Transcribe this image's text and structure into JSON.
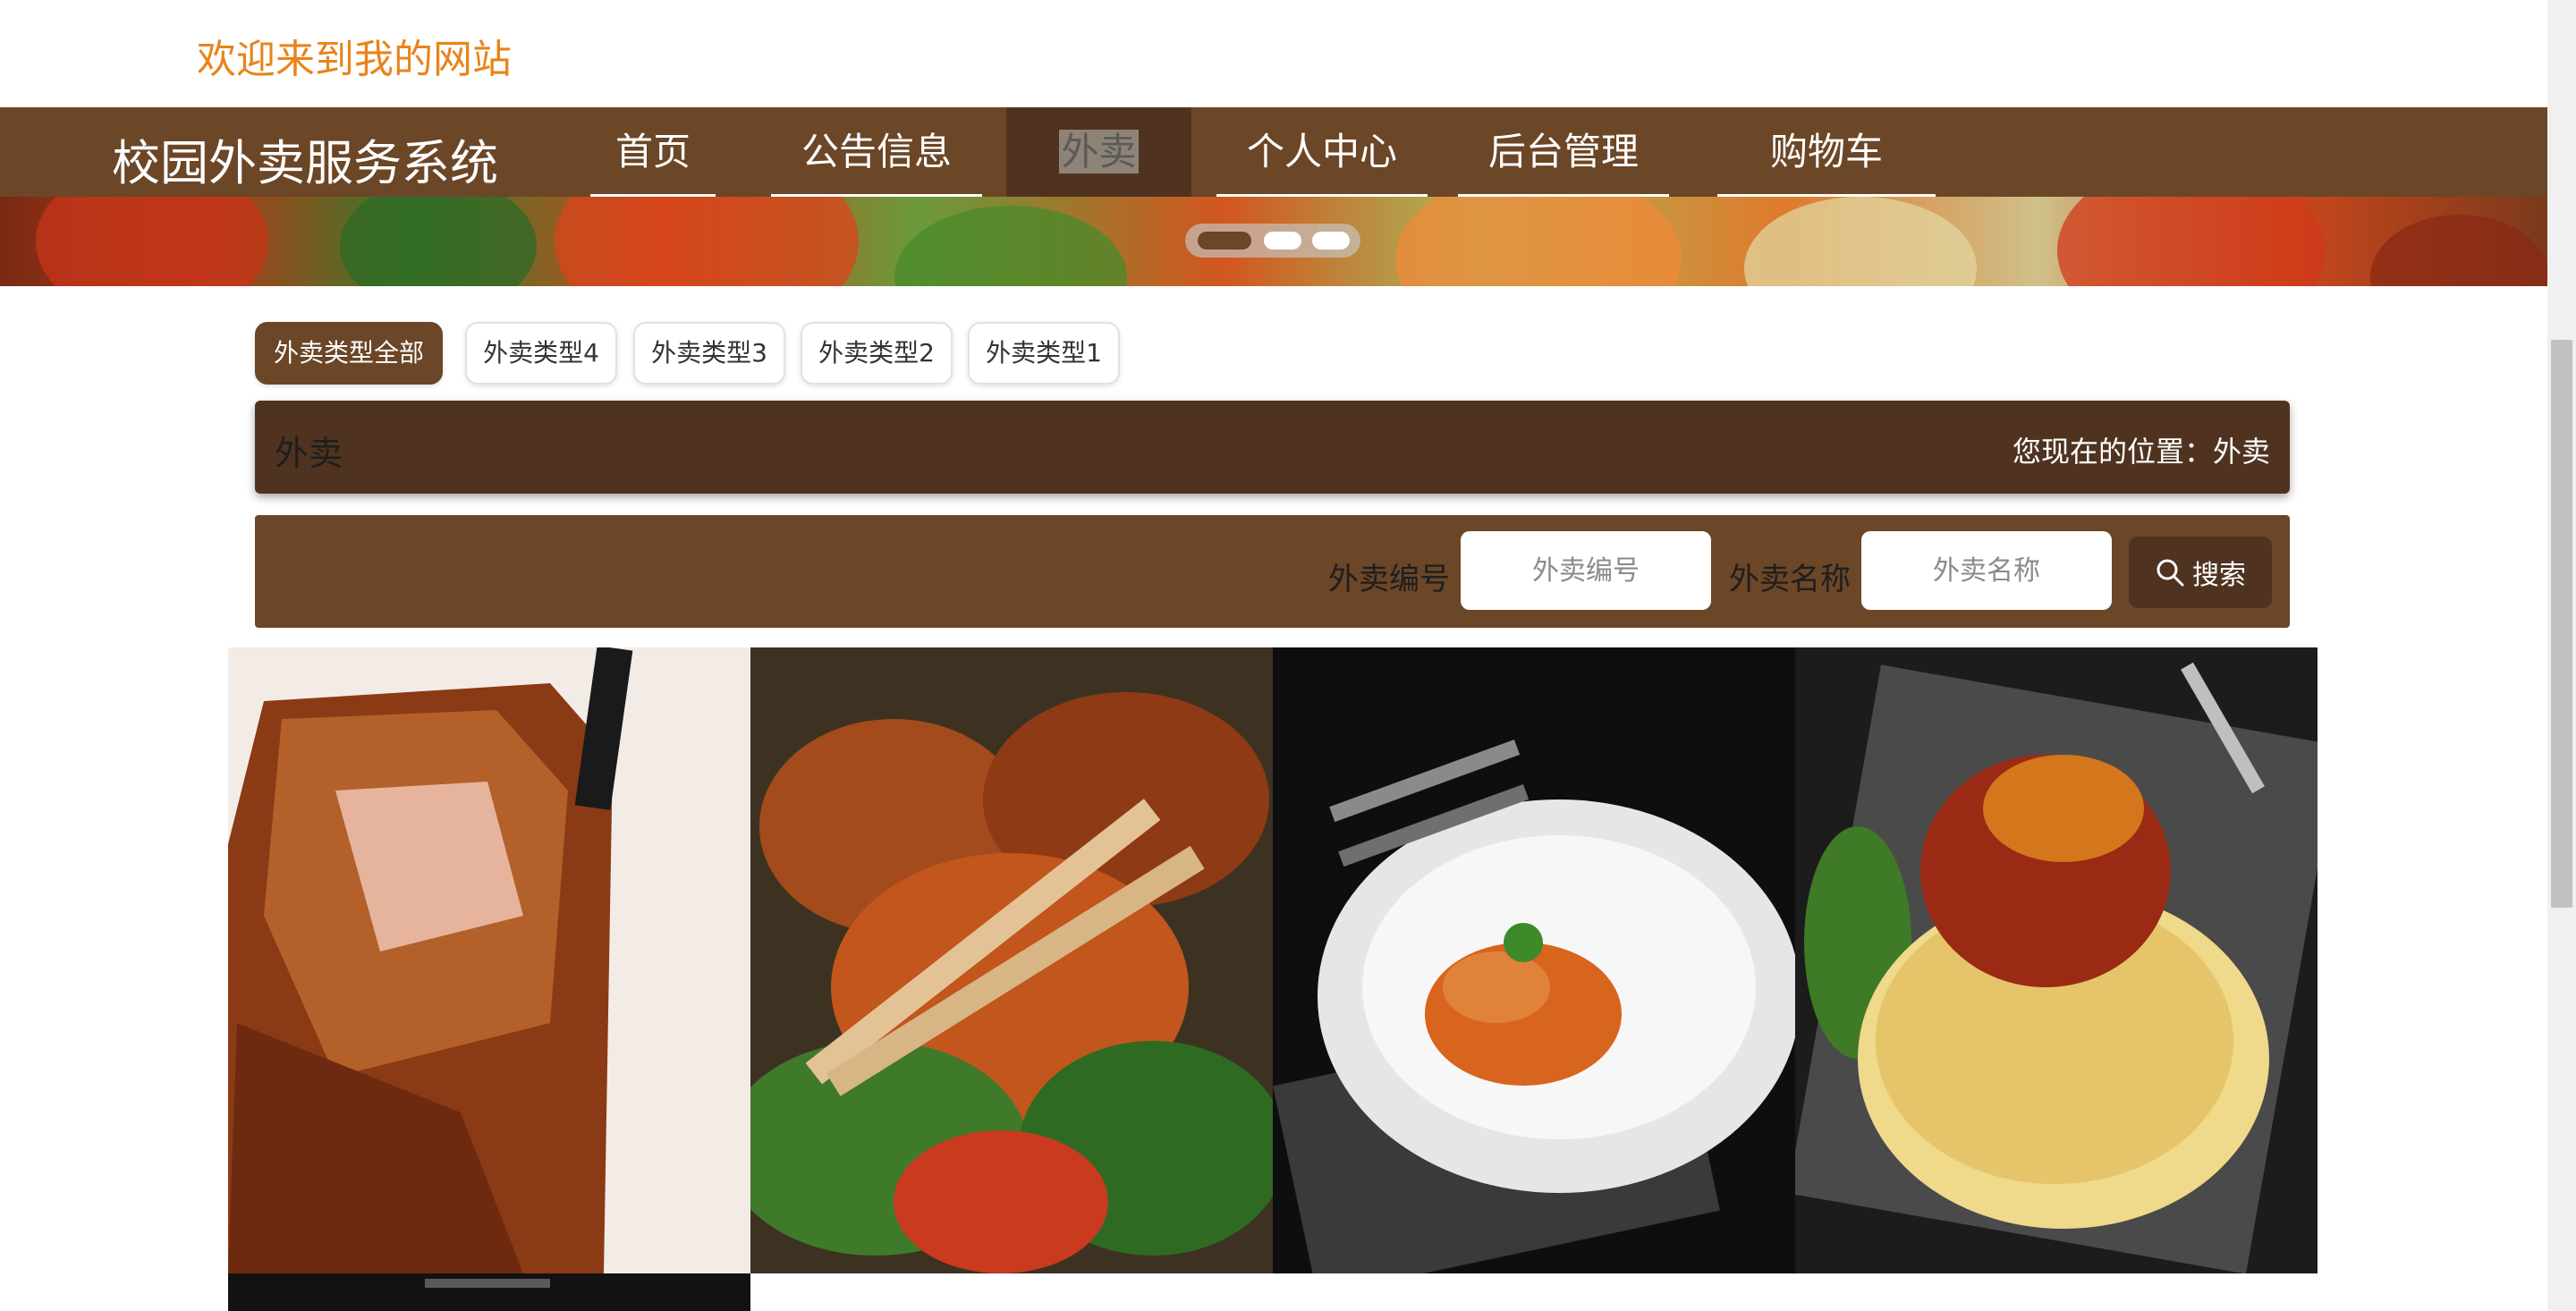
{
  "header": {
    "welcome": "欢迎来到我的网站"
  },
  "nav": {
    "brand": "校园外卖服务系统",
    "items": [
      {
        "label": "首页"
      },
      {
        "label": "公告信息"
      },
      {
        "label": "外卖",
        "active": true
      },
      {
        "label": "个人中心"
      },
      {
        "label": "后台管理"
      },
      {
        "label": "购物车"
      }
    ]
  },
  "carousel": {
    "slide_count": 3,
    "active_index": 0
  },
  "categories": [
    {
      "label": "外卖类型全部",
      "active": true
    },
    {
      "label": "外卖类型4"
    },
    {
      "label": "外卖类型3"
    },
    {
      "label": "外卖类型2"
    },
    {
      "label": "外卖类型1"
    }
  ],
  "breadcrumb": {
    "title": "外卖",
    "location": "您现在的位置：外卖"
  },
  "search": {
    "code_label": "外卖编号",
    "code_placeholder": "外卖编号",
    "name_label": "外卖名称",
    "name_placeholder": "外卖名称",
    "button_label": "搜索"
  },
  "products": [
    {
      "image": "braised-pork-belly-photo"
    },
    {
      "image": "stir-fried-pork-with-chopsticks-photo"
    },
    {
      "image": "plated-sweet-sour-fish-photo"
    },
    {
      "image": "spaghetti-bolognese-photo"
    },
    {
      "image": "dark-plate-photo-partial"
    }
  ],
  "colors": {
    "brand_brown": "#6b4627",
    "dark_brown": "#4f3320",
    "welcome_orange": "#e8841a"
  }
}
